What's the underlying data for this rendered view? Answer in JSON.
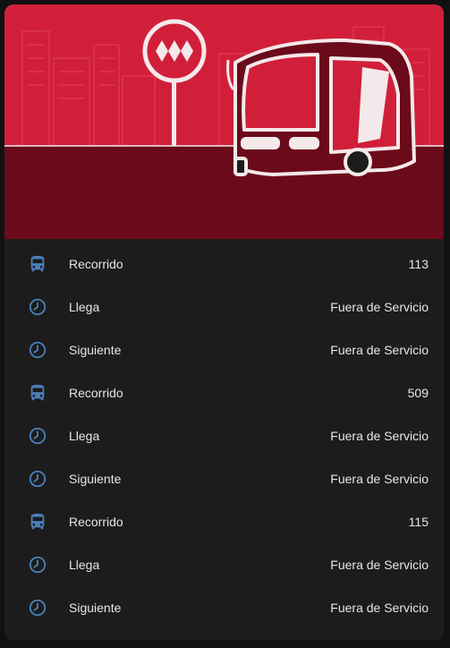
{
  "banner": {
    "image": "bus-stop-illustration",
    "colors": {
      "sky": "#d11f3a",
      "ground": "#6b0a1a",
      "buildings": "#e0455a",
      "line_art": "#f4e9ea"
    }
  },
  "accent_icon_color": "#4a7fb8",
  "rows": [
    {
      "icon": "bus-icon",
      "label": "Recorrido",
      "value": "113"
    },
    {
      "icon": "clock-icon",
      "label": "Llega",
      "value": "Fuera de Servicio"
    },
    {
      "icon": "clock-icon",
      "label": "Siguiente",
      "value": "Fuera de Servicio"
    },
    {
      "icon": "bus-icon",
      "label": "Recorrido",
      "value": "509"
    },
    {
      "icon": "clock-icon",
      "label": "Llega",
      "value": "Fuera de Servicio"
    },
    {
      "icon": "clock-icon",
      "label": "Siguiente",
      "value": "Fuera de Servicio"
    },
    {
      "icon": "bus-icon",
      "label": "Recorrido",
      "value": "115"
    },
    {
      "icon": "clock-icon",
      "label": "Llega",
      "value": "Fuera de Servicio"
    },
    {
      "icon": "clock-icon",
      "label": "Siguiente",
      "value": "Fuera de Servicio"
    }
  ]
}
